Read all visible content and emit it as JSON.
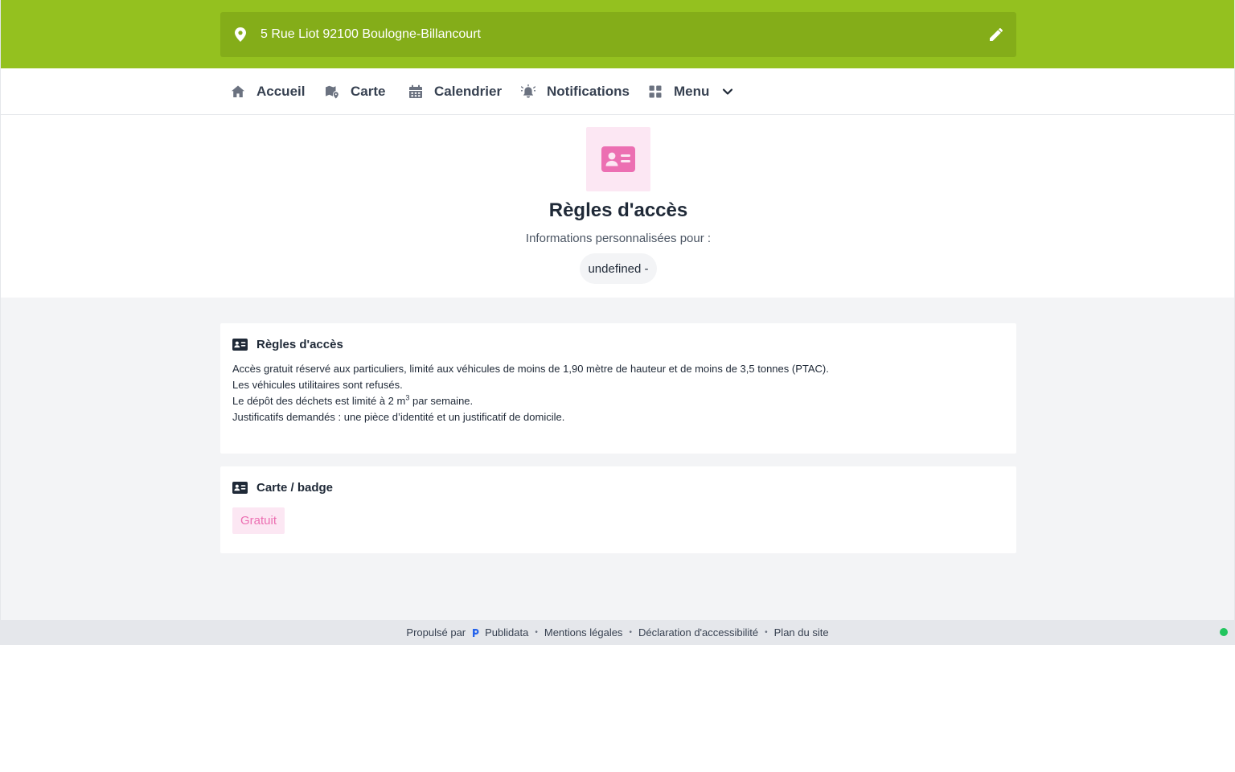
{
  "header": {
    "address": "5 Rue Liot 92100 Boulogne-Billancourt",
    "location_icon": "map-pin-icon",
    "edit_icon": "pencil-icon",
    "bar_color": "#94c11f"
  },
  "nav": {
    "items": [
      {
        "label": "Accueil",
        "icon": "home-icon"
      },
      {
        "label": "Carte",
        "icon": "map-icon"
      },
      {
        "label": "Calendrier",
        "icon": "calendar-icon"
      },
      {
        "label": "Notifications",
        "icon": "bell-icon"
      },
      {
        "label": "Menu",
        "icon": "grid-icon"
      }
    ]
  },
  "hero": {
    "icon": "id-card-icon",
    "title": "Règles d'accès",
    "subtitle": "Informations personnalisées pour :",
    "chip": "undefined -",
    "accent_color": "#ec6fb2"
  },
  "cards": {
    "access_rules": {
      "title": "Règles d'accès",
      "lines": [
        "Accès gratuit réservé aux particuliers, limité aux véhicules de moins de 1,90 mètre de hauteur et de moins de 3,5 tonnes (PTAC).",
        "Les véhicules utilitaires sont refusés.",
        "Le dépôt des déchets est limité à 2 m",
        "3",
        " par semaine.",
        "Justificatifs demandés : une pièce d’identité et un justificatif de domicile."
      ]
    },
    "badge": {
      "title": "Carte / badge",
      "tag": "Gratuit"
    }
  },
  "footer": {
    "powered_by": "Propulsé par",
    "brand": "Publidata",
    "links": [
      "Mentions légales",
      "Déclaration d'accessibilité",
      "Plan du site"
    ],
    "separator": "•",
    "status_color": "#22c55e"
  }
}
